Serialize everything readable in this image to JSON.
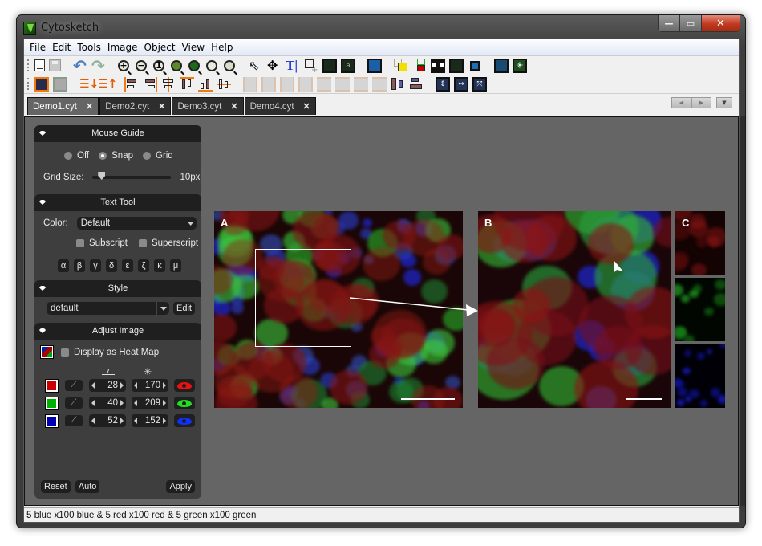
{
  "window": {
    "title": "Cytosketch",
    "caption_buttons": {
      "minimize": "—",
      "maximize": "▭",
      "close": "✕"
    }
  },
  "menubar": {
    "items": [
      "File",
      "Edit",
      "Tools",
      "Image",
      "Object",
      "View",
      "Help"
    ]
  },
  "toolbar": {
    "row1": [
      "new-document",
      "save",
      "undo",
      "redo",
      "zoom-in",
      "zoom-out",
      "zoom-actual-size",
      "zoom-fit-image",
      "zoom-fit-page",
      "zoom-selection",
      "zoom-layout",
      "select-pointer",
      "move",
      "text-tool",
      "add-shape",
      "insert-arrow-label",
      "insert-text-label",
      "insert-image",
      "bring-forward",
      "group-colors",
      "link-objects",
      "scale-bar",
      "crop",
      "levels-curve",
      "brightness"
    ],
    "row2": [
      "bring-to-front",
      "send-to-back",
      "sort-down",
      "sort-up",
      "align-left",
      "align-right",
      "align-center-h",
      "align-top",
      "align-bottom",
      "align-center-v",
      "distribute-h-1",
      "distribute-h-2",
      "distribute-h-3",
      "distribute-h-4",
      "distribute-v-1",
      "distribute-v-2",
      "distribute-v-3",
      "distribute-v-4",
      "size-width",
      "size-height",
      "fit-vertical",
      "fit-horizontal",
      "fit-all"
    ]
  },
  "tabs": [
    {
      "label": "Demo1.cyt",
      "active": true
    },
    {
      "label": "Demo2.cyt",
      "active": false
    },
    {
      "label": "Demo3.cyt",
      "active": false
    },
    {
      "label": "Demo4.cyt",
      "active": false
    }
  ],
  "tab_close_glyph": "✕",
  "tab_nav": {
    "prev": "◀",
    "next": "▶",
    "menu": "▼"
  },
  "panel": {
    "mouse_guide": {
      "title": "Mouse Guide",
      "options": [
        "Off",
        "Snap",
        "Grid"
      ],
      "selected": "Snap",
      "grid_size_label": "Grid Size:",
      "grid_size_value": "10px",
      "grid_slider_fraction": 0.12
    },
    "text_tool": {
      "title": "Text Tool",
      "color_label": "Color:",
      "color_value": "Default",
      "subscript_label": "Subscript",
      "superscript_label": "Superscript",
      "subscript_checked": false,
      "superscript_checked": false,
      "greek": [
        "α",
        "β",
        "γ",
        "δ",
        "ε",
        "ζ",
        "κ",
        "μ"
      ]
    },
    "style": {
      "title": "Style",
      "value": "default",
      "edit_label": "Edit"
    },
    "adjust_image": {
      "title": "Adjust Image",
      "heatmap_label": "Display as Heat Map",
      "heatmap_checked": false,
      "col_threshold_icon": "levels-icon",
      "col_brightness_icon": "brightness-icon",
      "channels": [
        {
          "name": "red",
          "color": "#cc0000",
          "min": "28",
          "max": "170"
        },
        {
          "name": "green",
          "color": "#00b000",
          "min": "40",
          "max": "209"
        },
        {
          "name": "blue",
          "color": "#0000b0",
          "min": "52",
          "max": "152"
        }
      ],
      "reset_label": "Reset",
      "auto_label": "Auto",
      "apply_label": "Apply"
    }
  },
  "figures": {
    "a_label": "A",
    "b_label": "B",
    "c_label": "C"
  },
  "statusbar": {
    "text": "5 blue x100 blue & 5 red x100 red & 5 green x100 green"
  }
}
